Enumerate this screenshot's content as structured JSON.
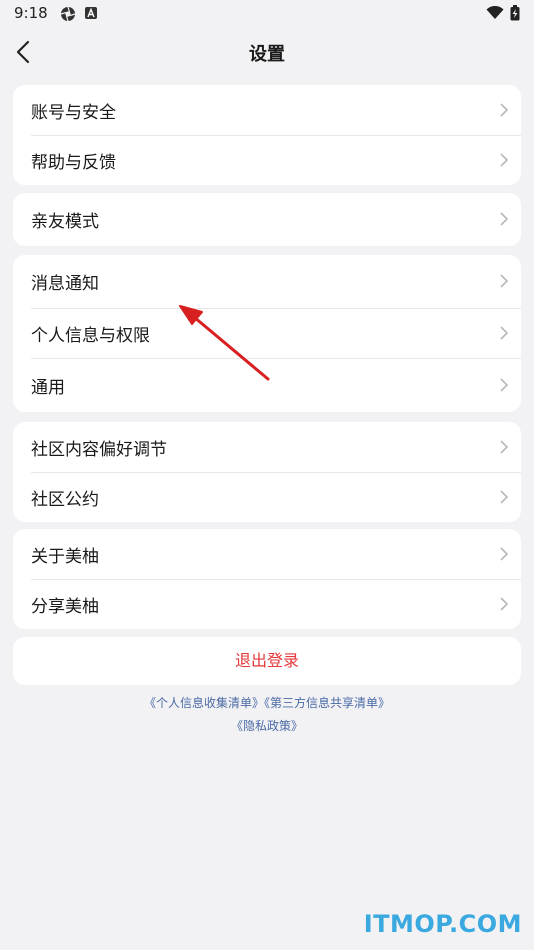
{
  "status_bar": {
    "time": "9:18",
    "icons": [
      "aperture-icon",
      "a-app-icon",
      "wifi-icon",
      "battery-charging-icon"
    ]
  },
  "header": {
    "title": "设置",
    "back_icon": "chevron-left-icon"
  },
  "groups": [
    {
      "items": [
        {
          "label": "账号与安全"
        },
        {
          "label": "帮助与反馈"
        }
      ]
    },
    {
      "items": [
        {
          "label": "亲友模式"
        }
      ]
    },
    {
      "items": [
        {
          "label": "消息通知"
        },
        {
          "label": "个人信息与权限"
        },
        {
          "label": "通用"
        }
      ]
    },
    {
      "items": [
        {
          "label": "社区内容偏好调节"
        },
        {
          "label": "社区公约"
        }
      ]
    },
    {
      "items": [
        {
          "label": "关于美柚"
        },
        {
          "label": "分享美柚"
        }
      ]
    }
  ],
  "logout": {
    "label": "退出登录",
    "color": "#e5383b"
  },
  "links": {
    "personal_info_list": "《个人信息收集清单》",
    "third_party_list": "《第三方信息共享清单》",
    "privacy_policy": "《隐私政策》"
  },
  "annotation": {
    "arrow_color": "#d92020"
  },
  "watermark": "ITMOP.COM"
}
